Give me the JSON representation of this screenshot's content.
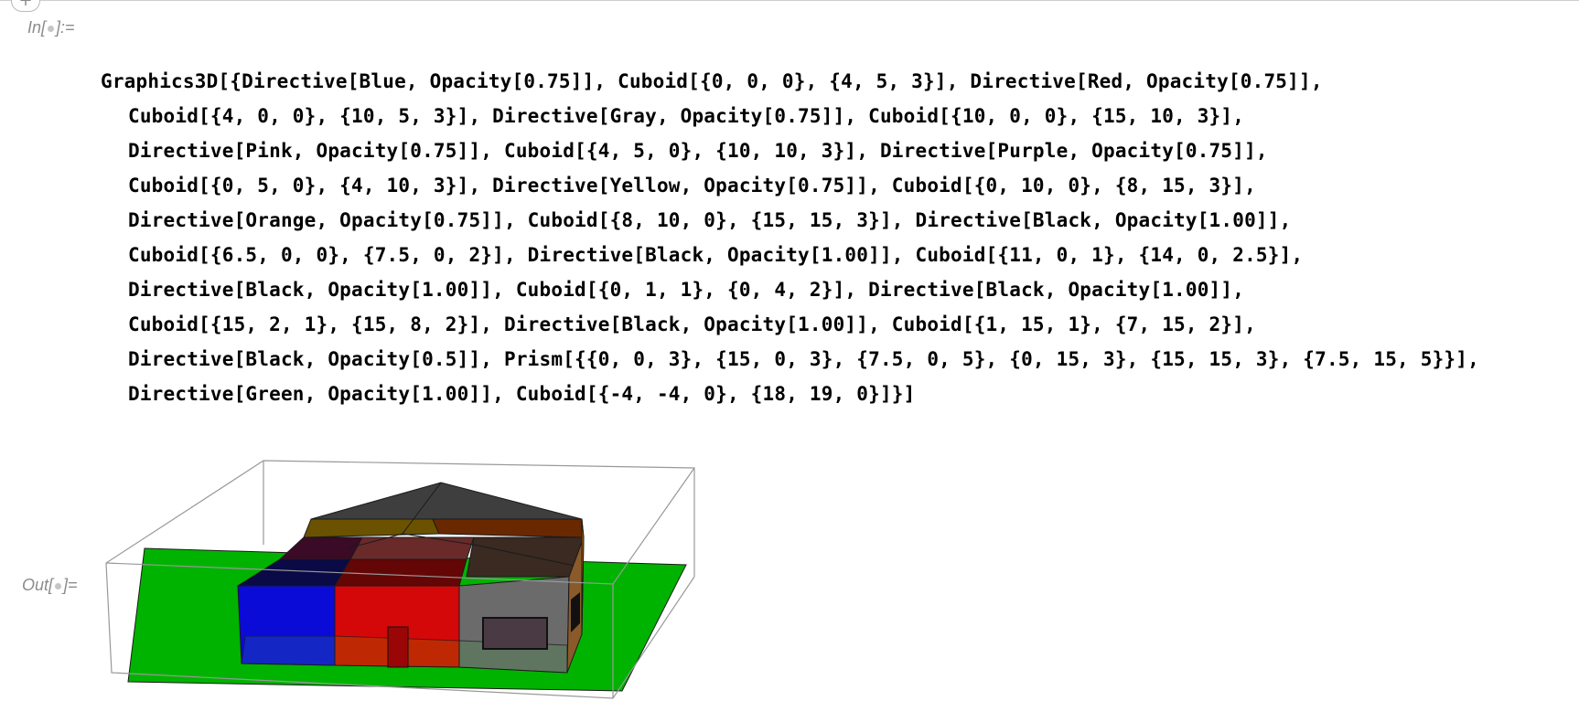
{
  "notebook": {
    "add_cell_glyph": "+",
    "input_label_prefix": "In[",
    "input_label_suffix": "]:=",
    "output_label_prefix": "Out[",
    "output_label_suffix": "]="
  },
  "input_cell": {
    "lines": [
      "Graphics3D[{Directive[Blue, Opacity[0.75]], Cuboid[{0, 0, 0}, {4, 5, 3}], Directive[Red, Opacity[0.75]],",
      "Cuboid[{4, 0, 0}, {10, 5, 3}], Directive[Gray, Opacity[0.75]], Cuboid[{10, 0, 0}, {15, 10, 3}],",
      "Directive[Pink, Opacity[0.75]], Cuboid[{4, 5, 0}, {10, 10, 3}], Directive[Purple, Opacity[0.75]],",
      "Cuboid[{0, 5, 0}, {4, 10, 3}], Directive[Yellow, Opacity[0.75]], Cuboid[{0, 10, 0}, {8, 15, 3}],",
      "Directive[Orange, Opacity[0.75]], Cuboid[{8, 10, 0}, {15, 15, 3}], Directive[Black, Opacity[1.00]],",
      "Cuboid[{6.5, 0, 0}, {7.5, 0, 2}], Directive[Black, Opacity[1.00]], Cuboid[{11, 0, 1}, {14, 0, 2.5}],",
      "Directive[Black, Opacity[1.00]], Cuboid[{0, 1, 1}, {0, 4, 2}], Directive[Black, Opacity[1.00]],",
      "Cuboid[{15, 2, 1}, {15, 8, 2}], Directive[Black, Opacity[1.00]], Cuboid[{1, 15, 1}, {7, 15, 2}],",
      "Directive[Black, Opacity[0.5]], Prism[{{0, 0, 3}, {15, 0, 3}, {7.5, 0, 5}, {0, 15, 3}, {15, 15, 3}, {7.5, 15, 5}}],",
      "Directive[Green, Opacity[1.00]], Cuboid[{-4, -4, 0}, {18, 19, 0}]}]"
    ]
  },
  "output_cell": {
    "render": {
      "ground": "#00b300",
      "blue": "#0a0ad6",
      "red": "#d10a0a",
      "gray": "#8e8e8e",
      "pink": "#e08090",
      "purple": "#7a2a7a",
      "yellow": "#d4b400",
      "orange": "#e07b00",
      "roof": "#333333"
    }
  }
}
